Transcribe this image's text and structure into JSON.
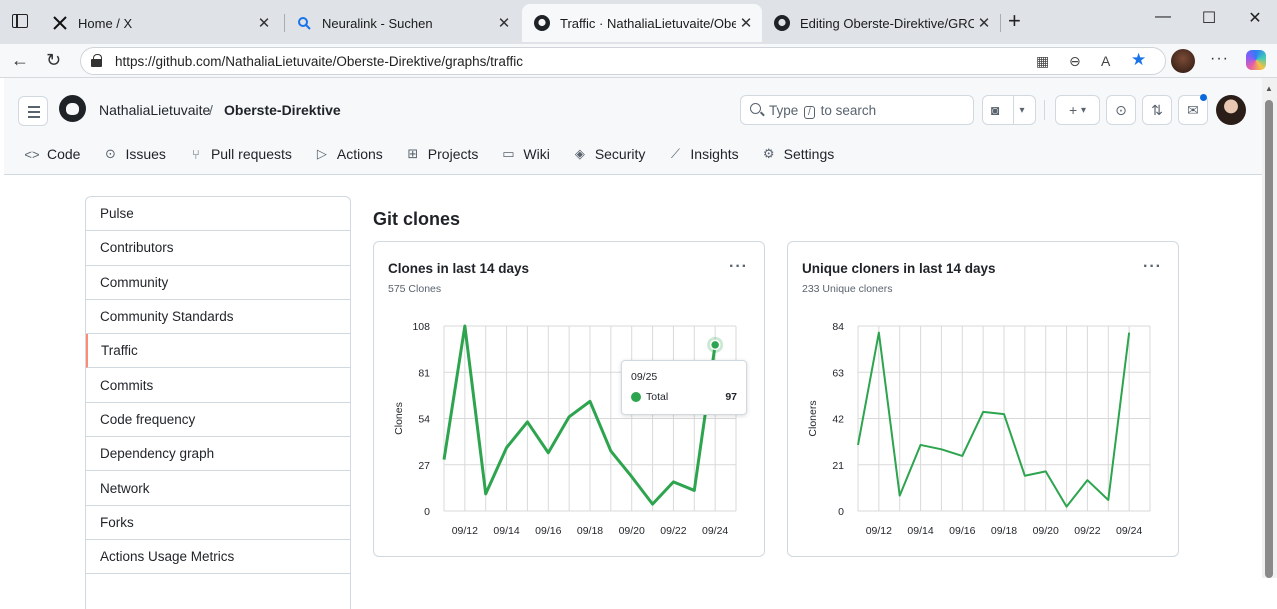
{
  "browser": {
    "tabs": [
      {
        "title": "Home / X",
        "icon": "x-logo-icon",
        "active": false
      },
      {
        "title": "Neuralink - Suchen",
        "icon": "search-icon",
        "active": false
      },
      {
        "title": "Traffic · NathaliaLietuvaite/Oberste",
        "icon": "github-icon",
        "active": true
      },
      {
        "title": "Editing Oberste-Direktive/GROK_I",
        "icon": "github-icon",
        "active": false
      }
    ],
    "url": "https://github.com/NathaliaLietuvaite/Oberste-Direktive/graphs/traffic"
  },
  "header": {
    "owner": "NathaliaLietuvaite",
    "separator": "/",
    "repo": "Oberste-Direktive",
    "search_prefix": "Type",
    "search_key": "/",
    "search_suffix": "to search"
  },
  "repo_nav": [
    {
      "label": "Code",
      "icon": "code-icon"
    },
    {
      "label": "Issues",
      "icon": "issue-icon"
    },
    {
      "label": "Pull requests",
      "icon": "pull-request-icon"
    },
    {
      "label": "Actions",
      "icon": "play-icon"
    },
    {
      "label": "Projects",
      "icon": "table-icon"
    },
    {
      "label": "Wiki",
      "icon": "book-icon"
    },
    {
      "label": "Security",
      "icon": "shield-icon"
    },
    {
      "label": "Insights",
      "icon": "graph-icon"
    },
    {
      "label": "Settings",
      "icon": "gear-icon"
    }
  ],
  "sidebar": {
    "items": [
      {
        "label": "Pulse",
        "selected": false
      },
      {
        "label": "Contributors",
        "selected": false
      },
      {
        "label": "Community",
        "selected": false
      },
      {
        "label": "Community Standards",
        "selected": false
      },
      {
        "label": "Traffic",
        "selected": true
      },
      {
        "label": "Commits",
        "selected": false
      },
      {
        "label": "Code frequency",
        "selected": false
      },
      {
        "label": "Dependency graph",
        "selected": false
      },
      {
        "label": "Network",
        "selected": false
      },
      {
        "label": "Forks",
        "selected": false
      },
      {
        "label": "Actions Usage Metrics",
        "selected": false
      }
    ]
  },
  "main": {
    "title": "Git clones"
  },
  "tooltip": {
    "date": "09/25",
    "label": "Total",
    "value": "97"
  },
  "colors": {
    "line": "#2da44e",
    "selected_indicator": "#fd8c73"
  },
  "chart_data": [
    {
      "type": "line",
      "title": "Clones in last 14 days",
      "subtitle": "575 Clones",
      "ylabel": "Clones",
      "xlabel": "",
      "x": [
        "09/11",
        "09/12",
        "09/13",
        "09/14",
        "09/15",
        "09/16",
        "09/17",
        "09/18",
        "09/19",
        "09/20",
        "09/21",
        "09/22",
        "09/23",
        "09/24",
        "09/25"
      ],
      "xticks": [
        "09/12",
        "09/14",
        "09/16",
        "09/18",
        "09/20",
        "09/22",
        "09/24"
      ],
      "yticks": [
        0,
        27,
        54,
        81,
        108
      ],
      "ylim": [
        0,
        108
      ],
      "series": [
        {
          "name": "Total",
          "values": [
            30,
            108,
            10,
            37,
            52,
            34,
            55,
            64,
            35,
            20,
            4,
            17,
            12,
            97
          ]
        }
      ],
      "highlight": {
        "x": "09/25",
        "value": 97
      },
      "grid": true
    },
    {
      "type": "line",
      "title": "Unique cloners in last 14 days",
      "subtitle": "233 Unique cloners",
      "ylabel": "Cloners",
      "xlabel": "",
      "x": [
        "09/11",
        "09/12",
        "09/13",
        "09/14",
        "09/15",
        "09/16",
        "09/17",
        "09/18",
        "09/19",
        "09/20",
        "09/21",
        "09/22",
        "09/23",
        "09/24",
        "09/25"
      ],
      "xticks": [
        "09/12",
        "09/14",
        "09/16",
        "09/18",
        "09/20",
        "09/22",
        "09/24"
      ],
      "yticks": [
        0,
        21,
        42,
        63,
        84
      ],
      "ylim": [
        0,
        84
      ],
      "series": [
        {
          "values": [
            30,
            81,
            7,
            30,
            28,
            25,
            45,
            44,
            16,
            18,
            2,
            14,
            5,
            81
          ]
        }
      ],
      "grid": true
    }
  ]
}
